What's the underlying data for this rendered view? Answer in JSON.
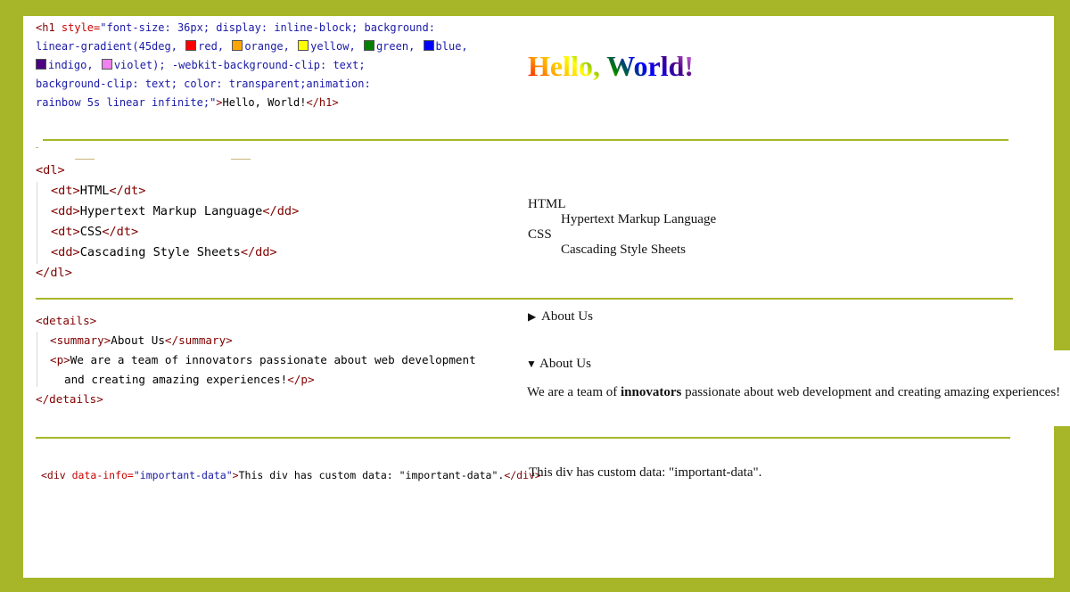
{
  "section1": {
    "code_line1": [
      "<h1 ",
      "style=",
      "\"font-size: 36px; display: inline-block; background:"
    ],
    "code_line2_pre": "linear-gradient(45deg, ",
    "colors": [
      {
        "name": "red",
        "hex": "#ff0000"
      },
      {
        "name": "orange",
        "hex": "#ffa500"
      },
      {
        "name": "yellow",
        "hex": "#ffff00"
      },
      {
        "name": "green",
        "hex": "#008000"
      },
      {
        "name": "blue",
        "hex": "#0000ff"
      },
      {
        "name": "indigo",
        "hex": "#4b0082"
      },
      {
        "name": "violet",
        "hex": "#ee82ee"
      }
    ],
    "sep": ", ",
    "code_line3_post": "); -webkit-background-clip: text;",
    "code_line4": "background-clip: text; color: transparent;animation:",
    "code_line5_val": "rainbow 5s linear infinite;\"",
    "code_line5_gt": ">",
    "code_line5_text": "Hello, World!",
    "code_line5_close": "</h1>",
    "output_heading": "Hello, World!"
  },
  "section2": {
    "code": {
      "dl_open": "<dl>",
      "dt_open": "<dt>",
      "dt_close": "</dt>",
      "dd_open": "<dd>",
      "dd_close": "</dd>",
      "term1": "HTML",
      "desc1": "Hypertext Markup Language",
      "term2": "CSS",
      "desc2": "Cascading Style Sheets",
      "dl_close": "</dl>"
    },
    "output": {
      "term1": "HTML",
      "desc1": "Hypertext Markup Language",
      "term2": "CSS",
      "desc2": "Cascading Style Sheets"
    }
  },
  "section3": {
    "code": {
      "details_open": "<details>",
      "summary_open": "<summary>",
      "summary_text": "About Us",
      "summary_close": "</summary>",
      "p_open": "<p>",
      "p_text1": "We are a team of innovators passionate about web development",
      "p_text2": "and creating amazing experiences!",
      "p_close": "</p>",
      "details_close": "</details>"
    },
    "output": {
      "collapsed_marker": "▶",
      "expanded_marker": "▼",
      "summary": "About Us",
      "para_pre": "We are a team of ",
      "para_bold": "innovators",
      "para_post": " passionate about web development and creating amazing experiences!"
    }
  },
  "section4": {
    "code": {
      "div_open": "<div ",
      "attr": "data-info=",
      "value": "\"important-data\"",
      "gt": ">",
      "text": "This div has custom data: \"important-data\".",
      "div_close": "</div>"
    },
    "output": "This div has custom data: \"important-data\"."
  },
  "colors": {
    "frame": "#a7b628",
    "tag": "#800000",
    "attribute": "#c80000",
    "value": "#1a1aa6"
  }
}
